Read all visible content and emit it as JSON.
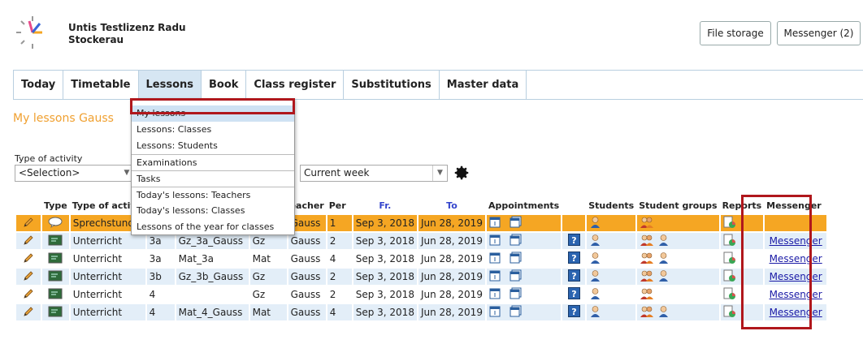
{
  "header": {
    "school_line1": "Untis Testlizenz Radu",
    "school_line2": "Stockerau",
    "file_storage": "File storage",
    "messenger": "Messenger (2)"
  },
  "nav": [
    {
      "label": "Today"
    },
    {
      "label": "Timetable"
    },
    {
      "label": "Lessons"
    },
    {
      "label": "Book"
    },
    {
      "label": "Class register"
    },
    {
      "label": "Substitutions"
    },
    {
      "label": "Master data"
    }
  ],
  "page_title": "My lessons Gauss",
  "filters": {
    "type_label": "Type of activity",
    "type_value": "<Selection>",
    "period_value": "Current week"
  },
  "dropdown": [
    {
      "label": "My lessons"
    },
    {
      "label": "Lessons: Classes"
    },
    {
      "label": "Lessons: Students"
    },
    {
      "label": "Examinations"
    },
    {
      "label": "Tasks"
    },
    {
      "label": "Today's lessons: Teachers"
    },
    {
      "label": "Today's lessons: Classes"
    },
    {
      "label": "Lessons of the year for classes"
    }
  ],
  "table": {
    "headers": {
      "type": "Type",
      "type_of_activity": "Type of activit",
      "teacher": "eacher",
      "per": "Per",
      "from": "Fr.",
      "to": "To",
      "appointments": "Appointments",
      "students": "Students",
      "student_groups": "Student groups",
      "reports": "Reports",
      "messenger": "Messenger"
    },
    "rows": [
      {
        "activity": "Sprechstund",
        "cls": "",
        "lesson": "",
        "subject": "",
        "teacher": "Gauss",
        "per": "1",
        "from": "Sep 3, 2018",
        "to": "Jun 28, 2019",
        "messenger": ""
      },
      {
        "activity": "Unterricht",
        "cls": "3a",
        "lesson": "Gz_3a_Gauss",
        "subject": "Gz",
        "teacher": "Gauss",
        "per": "2",
        "from": "Sep 3, 2018",
        "to": "Jun 28, 2019",
        "messenger": "Messenger"
      },
      {
        "activity": "Unterricht",
        "cls": "3a",
        "lesson": "Mat_3a",
        "subject": "Mat",
        "teacher": "Gauss",
        "per": "4",
        "from": "Sep 3, 2018",
        "to": "Jun 28, 2019",
        "messenger": "Messenger"
      },
      {
        "activity": "Unterricht",
        "cls": "3b",
        "lesson": "Gz_3b_Gauss",
        "subject": "Gz",
        "teacher": "Gauss",
        "per": "2",
        "from": "Sep 3, 2018",
        "to": "Jun 28, 2019",
        "messenger": "Messenger"
      },
      {
        "activity": "Unterricht",
        "cls": "4",
        "lesson": "",
        "subject": "Gz",
        "teacher": "Gauss",
        "per": "2",
        "from": "Sep 3, 2018",
        "to": "Jun 28, 2019",
        "messenger": "Messenger"
      },
      {
        "activity": "Unterricht",
        "cls": "4",
        "lesson": "Mat_4_Gauss",
        "subject": "Mat",
        "teacher": "Gauss",
        "per": "4",
        "from": "Sep 3, 2018",
        "to": "Jun 28, 2019",
        "messenger": "Messenger"
      }
    ]
  },
  "colors": {
    "accent_orange": "#f5a623",
    "row_light": "#e3eef8",
    "highlight_red": "#b0171c",
    "title_orange": "#f0a030"
  }
}
